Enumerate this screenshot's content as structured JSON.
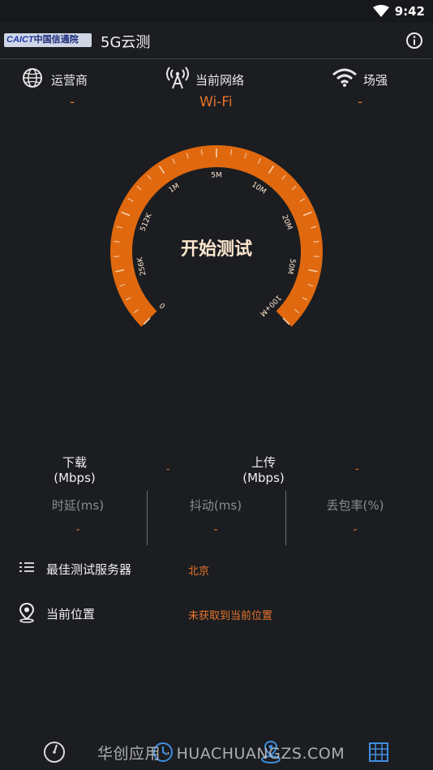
{
  "status_bar": {
    "time": "9:42"
  },
  "app_bar": {
    "logo_text": "CAICT",
    "logo_cn": "中国信通院",
    "title": "5G云测"
  },
  "info": {
    "operator_label": "运营商",
    "operator_value": "-",
    "network_label": "当前网络",
    "network_value": "Wi-Fi",
    "signal_label": "场强",
    "signal_value": "-"
  },
  "gauge": {
    "start_label": "开始测试",
    "ticks": [
      "0",
      "256K",
      "512K",
      "1M",
      "5M",
      "10M",
      "20M",
      "50M",
      "100+M"
    ],
    "colors": {
      "arc": "#e0690f",
      "tick": "#f6d2b0",
      "text": "#ffe7cf"
    }
  },
  "stats": {
    "download_label": "下载",
    "download_unit": "(Mbps)",
    "download_value": "-",
    "upload_label": "上传",
    "upload_unit": "(Mbps)",
    "upload_value": "-"
  },
  "metrics": [
    {
      "label": "时延(ms)",
      "value": "-"
    },
    {
      "label": "抖动(ms)",
      "value": "-"
    },
    {
      "label": "丢包率(%)",
      "value": "-"
    }
  ],
  "server": {
    "label": "最佳测试服务器",
    "value": "北京"
  },
  "location": {
    "label": "当前位置",
    "value": "未获取到当前位置"
  },
  "watermark": "华创应用 · HUACHUANGZS.COM",
  "accent": "#e8732b"
}
